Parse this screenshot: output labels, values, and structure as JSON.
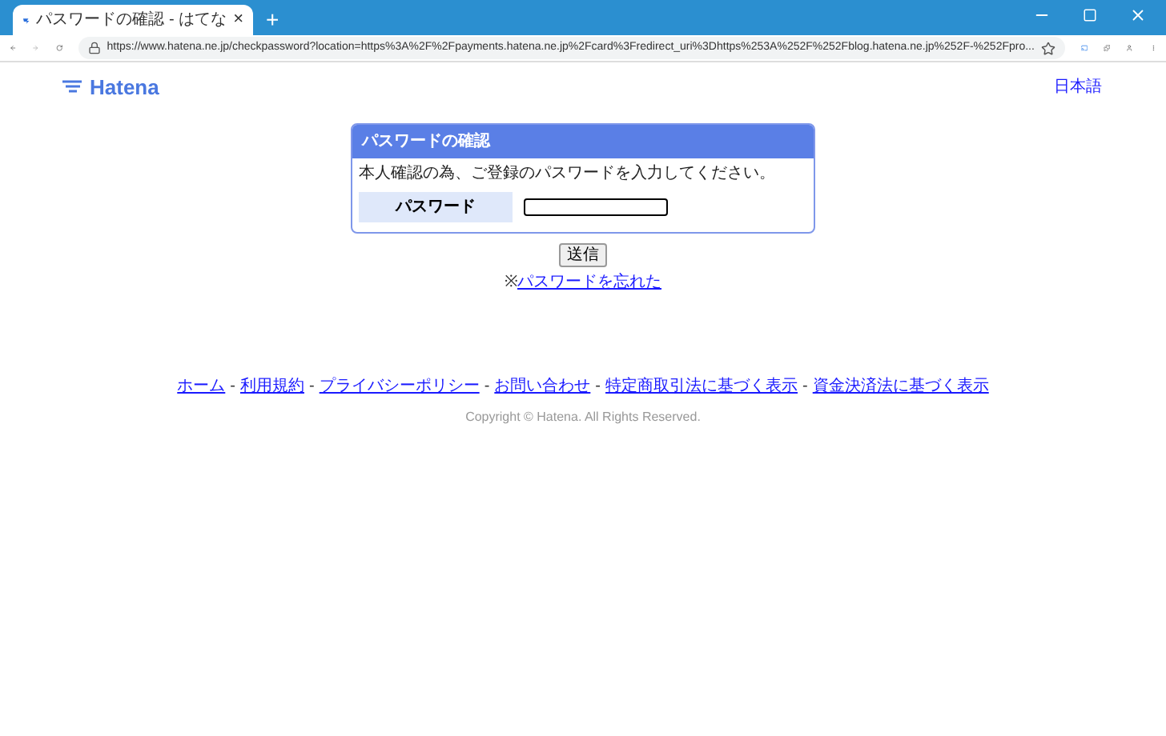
{
  "browser": {
    "tab_title": "パスワードの確認 - はてな",
    "tab_close": "×",
    "new_tab": "+",
    "url": "https://www.hatena.ne.jp/checkpassword?location=https%3A%2F%2Fpayments.hatena.ne.jp%2Fcard%3Fredirect_uri%3Dhttps%253A%252F%252Fblog.hatena.ne.jp%252F-%252Fpro..."
  },
  "header": {
    "logo": "Hatena",
    "language": "日本語"
  },
  "dialog": {
    "title": "パスワードの確認",
    "message": "本人確認の為、ご登録のパスワードを入力してください。",
    "field_label": "パスワード",
    "submit": "送信",
    "forgot_prefix": "※",
    "forgot_link": "パスワードを忘れた"
  },
  "footer": {
    "links": [
      "ホーム",
      "利用規約",
      "プライバシーポリシー",
      "お問い合わせ",
      "特定商取引法に基づく表示",
      "資金決済法に基づく表示"
    ],
    "separator": "-",
    "copyright": "Copyright © Hatena. All Rights Reserved."
  }
}
